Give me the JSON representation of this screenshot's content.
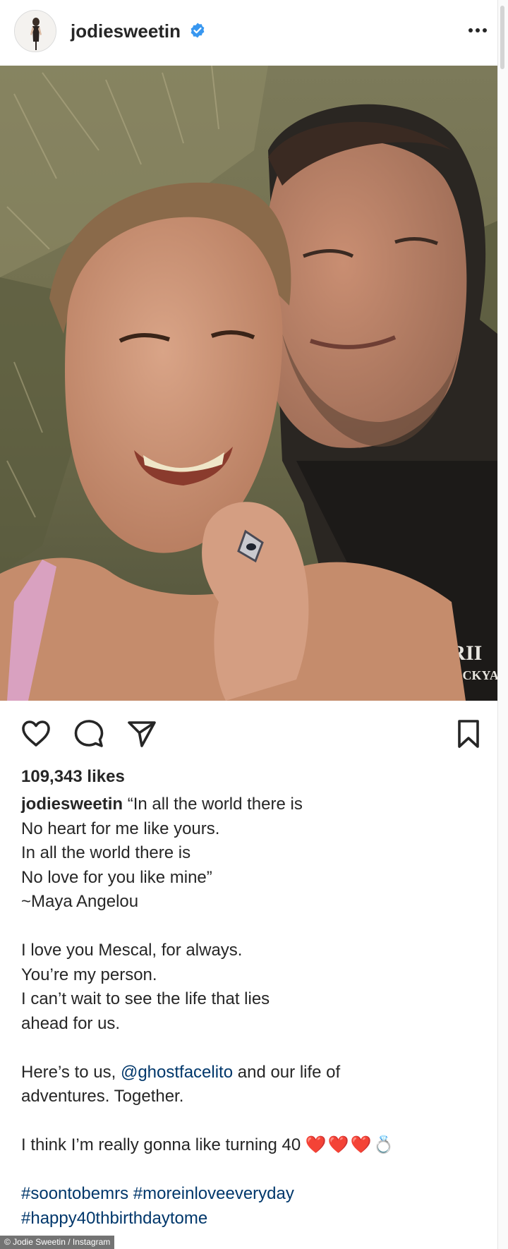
{
  "header": {
    "username": "jodiesweetin",
    "verified_color": "#3897f0",
    "avatar_icon": "profile-photo",
    "more_icon": "more-dots-icon"
  },
  "photo": {
    "shirt_text_1": "KRII",
    "shirt_text_2": "- BACKYA"
  },
  "actions": {
    "like_icon": "heart-outline-icon",
    "comment_icon": "comment-bubble-icon",
    "share_icon": "paper-plane-icon",
    "save_icon": "bookmark-icon"
  },
  "likes": "109,343 likes",
  "caption": {
    "username": "jodiesweetin",
    "line1": "“In all the world there is",
    "line2": "No heart for me like yours.",
    "line3": "In all the world there is",
    "line4": "No love for you like mine”",
    "line5": "~Maya Angelou",
    "line6": "I love you Mescal, for always.",
    "line7": "You’re my person.",
    "line8": "I can’t wait to see the life that lies",
    "line9": "ahead for us.",
    "line10_pre": "Here’s to us, ",
    "line10_mention": "@ghostfacelito",
    "line10_post": " and our life of",
    "line11": "adventures. Together.",
    "line12": "I think I’m really gonna like turning 40 ",
    "line12_emoji": "❤️❤️❤️💍",
    "hashtags1": "#soontobemrs #moreinloveeveryday",
    "hashtags2": "#happy40thbirthdaytome"
  },
  "credit": "© Jodie Sweetin / Instagram",
  "colors": {
    "text": "#262626",
    "link": "#00376b",
    "heart": "#e0245e"
  }
}
